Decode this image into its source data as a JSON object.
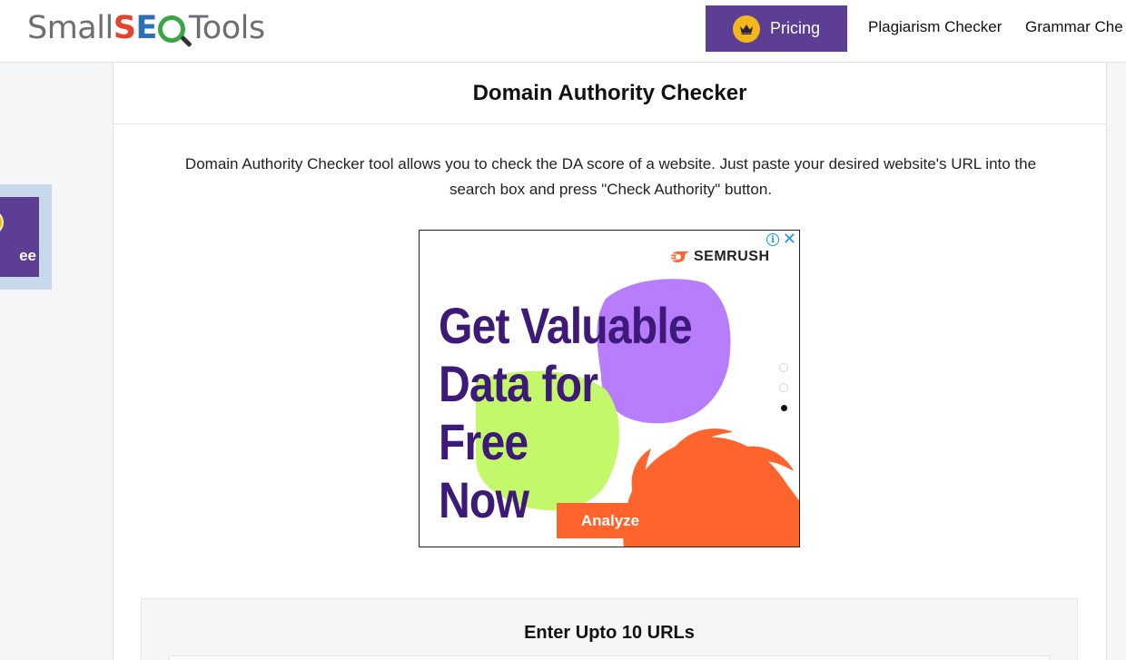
{
  "header": {
    "logo": {
      "part1": "Small",
      "part2_s": "S",
      "part2_e": "E",
      "part3": "Tools"
    },
    "pricing_label": "Pricing",
    "nav": [
      "Plagiarism Checker",
      "Grammar Che"
    ]
  },
  "side_promo": {
    "text": "ee"
  },
  "page": {
    "title": "Domain Authority Checker",
    "description": "Domain Authority Checker tool allows you to check the DA score of a website. Just paste your desired website's URL into the search box and press \"Check Authority\" button."
  },
  "ad": {
    "brand": "SEMRUSH",
    "headline_line1": "Get Valuable",
    "headline_line2": "Data for Free",
    "headline_line3": "Now",
    "cta": "Analyze",
    "info_glyph": "i",
    "close_glyph": "✕",
    "colors": {
      "purple_blob": "#b77dfc",
      "green_blob": "#c4f86b",
      "orange_burst": "#ff642d",
      "headline": "#3d1a78"
    },
    "carousel_active_index": 2
  },
  "url_form": {
    "heading": "Enter Upto 10 URLs"
  },
  "colors": {
    "brand_purple": "#5c3f95",
    "crown_yellow": "#f4b71b"
  }
}
